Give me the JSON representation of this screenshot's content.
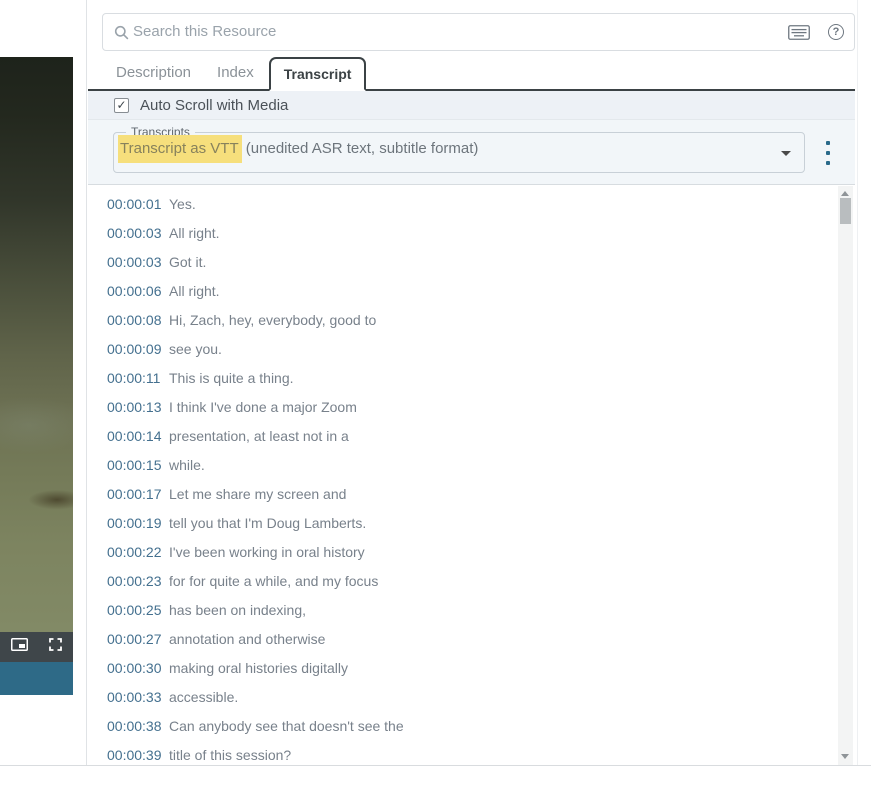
{
  "search": {
    "placeholder": "Search this Resource"
  },
  "tabs": {
    "items": [
      {
        "label": "Description"
      },
      {
        "label": "Index"
      },
      {
        "label": "Transcript"
      }
    ],
    "active": "Transcript"
  },
  "autoscroll": {
    "label": "Auto Scroll with Media",
    "checked": true,
    "check_glyph": "✓"
  },
  "transcripts_select": {
    "label": "Transcripts",
    "selected_highlight": "Transcript as VTT",
    "selected_rest": " (unedited ASR text, subtitle format)",
    "highlight_color": "#f6df7c"
  },
  "player": {
    "icons": [
      "picture-in-picture",
      "fullscreen"
    ],
    "accent_color": "#2e6a87",
    "controls_color": "#3f464a"
  },
  "transcript_rows": [
    {
      "time": "00:00:01",
      "text": "Yes."
    },
    {
      "time": "00:00:03",
      "text": "All right."
    },
    {
      "time": "00:00:03",
      "text": "Got it."
    },
    {
      "time": "00:00:06",
      "text": "All right."
    },
    {
      "time": "00:00:08",
      "text": "Hi, Zach, hey, everybody, good to"
    },
    {
      "time": "00:00:09",
      "text": "see you."
    },
    {
      "time": "00:00:11",
      "text": "This is quite a thing."
    },
    {
      "time": "00:00:13",
      "text": "I think I've done a major Zoom"
    },
    {
      "time": "00:00:14",
      "text": "presentation, at least not in a"
    },
    {
      "time": "00:00:15",
      "text": "while."
    },
    {
      "time": "00:00:17",
      "text": "Let me share my screen and"
    },
    {
      "time": "00:00:19",
      "text": "tell you that I'm Doug Lamberts."
    },
    {
      "time": "00:00:22",
      "text": "I've been working in oral history"
    },
    {
      "time": "00:00:23",
      "text": "for for quite a while, and my focus"
    },
    {
      "time": "00:00:25",
      "text": "has been on indexing,"
    },
    {
      "time": "00:00:27",
      "text": "annotation and otherwise"
    },
    {
      "time": "00:00:30",
      "text": "making oral histories digitally"
    },
    {
      "time": "00:00:33",
      "text": "accessible."
    },
    {
      "time": "00:00:38",
      "text": "Can anybody see that doesn't see the"
    },
    {
      "time": "00:00:39",
      "text": "title of this session?"
    }
  ],
  "colors": {
    "timestamp": "#44708f",
    "row_text": "#78818b",
    "highlight": "#f6df7c",
    "accent_teal": "#2e6a87"
  }
}
